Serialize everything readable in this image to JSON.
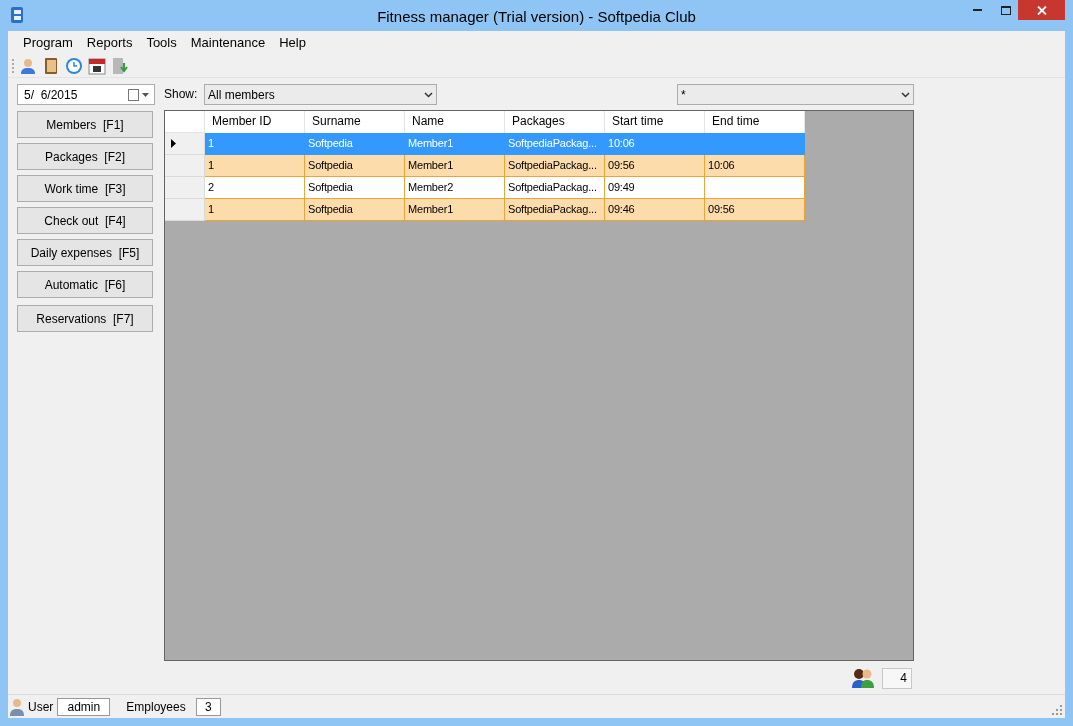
{
  "window": {
    "title": "Fitness manager (Trial version) - Softpedia Club"
  },
  "menu": [
    "Program",
    "Reports",
    "Tools",
    "Maintenance",
    "Help"
  ],
  "date_field": {
    "value": "5/  6/2015"
  },
  "nav_buttons": [
    "Members  [F1]",
    "Packages  [F2]",
    "Work time  [F3]",
    "Check out  [F4]",
    "Daily expenses  [F5]",
    "Automatic  [F6]",
    "Reservations  [F7]"
  ],
  "show": {
    "label": "Show:",
    "value": "All members"
  },
  "filter": {
    "value": "*"
  },
  "table": {
    "columns": [
      "Member ID",
      "Surname",
      "Name",
      "Packages",
      "Start time",
      "End time"
    ],
    "rows": [
      {
        "selected": true,
        "highlighted": false,
        "cells": [
          "1",
          "Softpedia",
          "Member1",
          "SoftpediaPackag...",
          "10:06",
          ""
        ]
      },
      {
        "selected": false,
        "highlighted": true,
        "cells": [
          "1",
          "Softpedia",
          "Member1",
          "SoftpediaPackag...",
          "09:56",
          "10:06"
        ]
      },
      {
        "selected": false,
        "highlighted": false,
        "cells": [
          "2",
          "Softpedia",
          "Member2",
          "SoftpediaPackag...",
          "09:49",
          ""
        ]
      },
      {
        "selected": false,
        "highlighted": true,
        "cells": [
          "1",
          "Softpedia",
          "Member1",
          "SoftpediaPackag...",
          "09:46",
          "09:56"
        ]
      }
    ]
  },
  "count": "4",
  "status_bar": {
    "user_label": "User",
    "user": "admin",
    "employees_label": "Employees",
    "employees": "3"
  }
}
